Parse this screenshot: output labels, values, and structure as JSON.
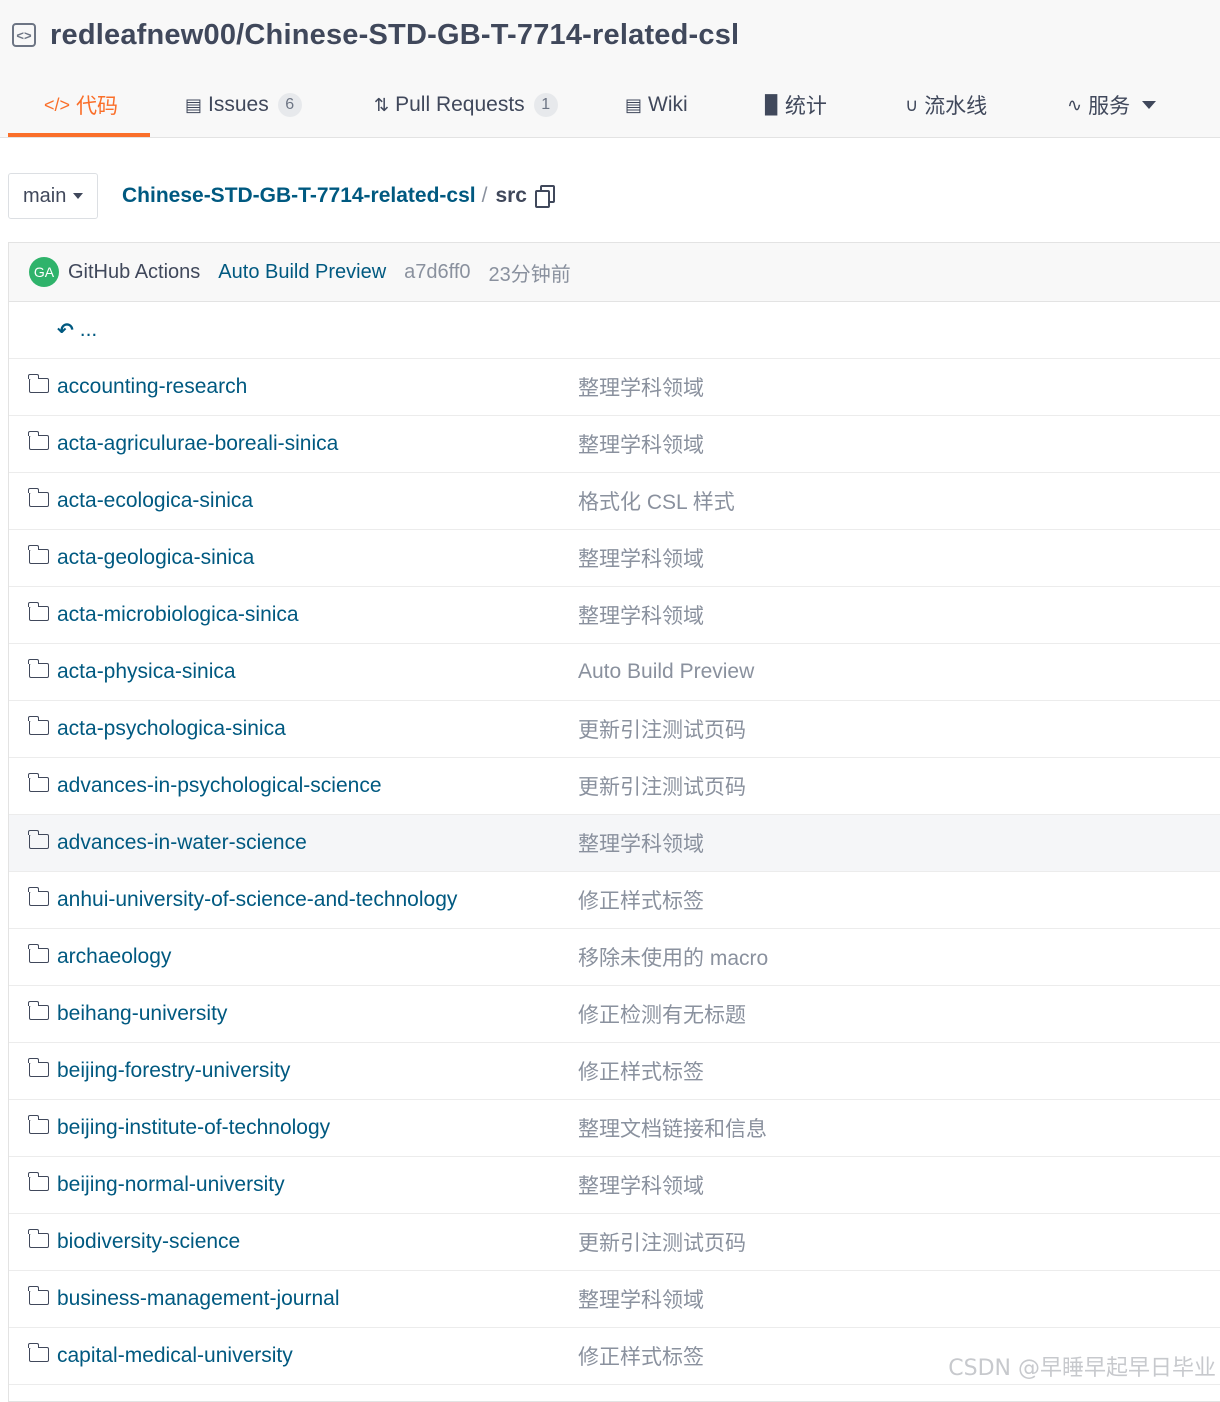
{
  "repo": {
    "full_name": "redleafnew00/Chinese-STD-GB-T-7714-related-csl"
  },
  "tabs": [
    {
      "label": "代码",
      "icon": "code-icon"
    },
    {
      "label": "Issues",
      "icon": "issues-icon",
      "count": "6"
    },
    {
      "label": "Pull Requests",
      "icon": "pull-request-icon",
      "count": "1"
    },
    {
      "label": "Wiki",
      "icon": "wiki-icon"
    },
    {
      "label": "统计",
      "icon": "stats-icon"
    },
    {
      "label": "流水线",
      "icon": "pipeline-icon"
    },
    {
      "label": "服务",
      "icon": "activity-icon"
    }
  ],
  "branch": {
    "name": "main"
  },
  "breadcrumb": {
    "repo": "Chinese-STD-GB-T-7714-related-csl",
    "separator": "/",
    "dir": "src"
  },
  "commit": {
    "avatar_initials": "GA",
    "author": "GitHub Actions",
    "message": "Auto Build Preview",
    "sha": "a7d6ff0",
    "time": "23分钟前"
  },
  "parent_link": "...",
  "files": [
    {
      "name": "accounting-research",
      "message": "整理学科领域"
    },
    {
      "name": "acta-agriculurae-boreali-sinica",
      "message": "整理学科领域"
    },
    {
      "name": "acta-ecologica-sinica",
      "message": "格式化 CSL 样式"
    },
    {
      "name": "acta-geologica-sinica",
      "message": "整理学科领域"
    },
    {
      "name": "acta-microbiologica-sinica",
      "message": "整理学科领域"
    },
    {
      "name": "acta-physica-sinica",
      "message": "Auto Build Preview"
    },
    {
      "name": "acta-psychologica-sinica",
      "message": "更新引注测试页码"
    },
    {
      "name": "advances-in-psychological-science",
      "message": "更新引注测试页码"
    },
    {
      "name": "advances-in-water-science",
      "message": "整理学科领域"
    },
    {
      "name": "anhui-university-of-science-and-technology",
      "message": "修正样式标签"
    },
    {
      "name": "archaeology",
      "message": "移除未使用的 macro"
    },
    {
      "name": "beihang-university",
      "message": "修正检测有无标题"
    },
    {
      "name": "beijing-forestry-university",
      "message": "修正样式标签"
    },
    {
      "name": "beijing-institute-of-technology",
      "message": "整理文档链接和信息"
    },
    {
      "name": "beijing-normal-university",
      "message": "整理学科领域"
    },
    {
      "name": "biodiversity-science",
      "message": "更新引注测试页码"
    },
    {
      "name": "business-management-journal",
      "message": "整理学科领域"
    },
    {
      "name": "capital-medical-university",
      "message": "修正样式标签"
    }
  ],
  "watermark": "CSDN @早睡早起早日毕业",
  "colors": {
    "accent": "#fa6f2a",
    "link": "#005980",
    "muted": "#8a919e",
    "text": "#40485b"
  }
}
